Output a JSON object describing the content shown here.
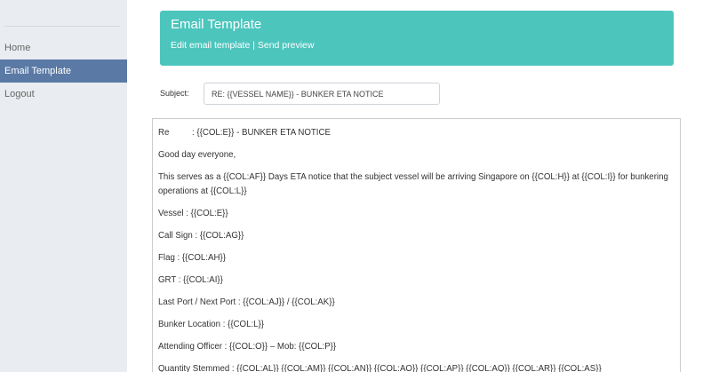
{
  "sidebar": {
    "items": [
      {
        "label": "Home",
        "active": false
      },
      {
        "label": "Email Template",
        "active": true
      },
      {
        "label": "Logout",
        "active": false
      }
    ]
  },
  "header": {
    "title": "Email Template",
    "link_edit": "Edit email template",
    "link_separator": " | ",
    "link_preview": "Send preview",
    "bg_color": "#4cc5bd"
  },
  "subject": {
    "label": "Subject:",
    "value": "RE: {{VESSEL NAME}} - BUNKER ETA NOTICE"
  },
  "body": {
    "re_label": "Re",
    "re_value": ": {{COL:E}} - BUNKER ETA NOTICE",
    "lines": [
      "Good day everyone,",
      "This serves as a {{COL:AF}} Days ETA notice that the subject vessel will be arriving Singapore on {{COL:H}} at {{COL:I}} for bunkering operations at {{COL:L}}",
      "Vessel : {{COL:E}}",
      "Call Sign : {{COL:AG}}",
      "Flag : {{COL:AH}}",
      "GRT : {{COL:AI}}",
      "Last Port / Next Port : {{COL:AJ}} / {{COL:AK}}",
      "Bunker Location : {{COL:L}}",
      "Attending Officer : {{COL:O}} – Mob: {{COL:P}}",
      "Quantity Stemmed : {{COL:AL}} {{COL:AM}} {{COL:AN}} {{COL:AO}} {{COL:AP}} {{COL:AQ}} {{COL:AR}} {{COL:AS}}"
    ]
  },
  "colors": {
    "sidebar_bg": "#e9ecf0",
    "active_item": "#5a7aa5"
  }
}
